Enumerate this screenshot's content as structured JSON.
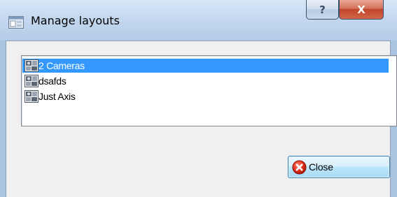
{
  "window": {
    "title": "Manage layouts",
    "help_label": "?",
    "close_label": "X"
  },
  "layouts": {
    "items": [
      {
        "label": "2 Cameras",
        "selected": true
      },
      {
        "label": "dsafds",
        "selected": false
      },
      {
        "label": "Just Axis",
        "selected": false
      }
    ]
  },
  "footer": {
    "close_label": "Close"
  },
  "colors": {
    "selection": "#3399ff",
    "titlebar": "#c4d8ef",
    "close_caption": "#c1452c"
  }
}
